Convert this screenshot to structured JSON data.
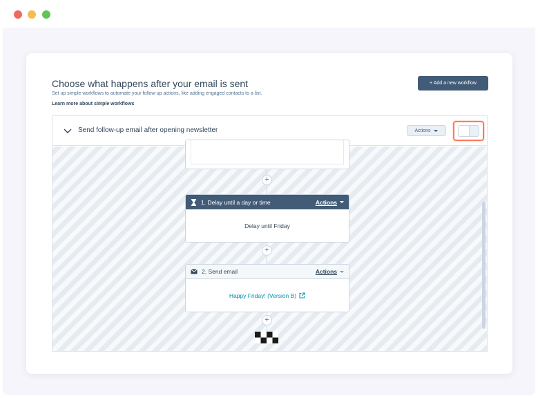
{
  "window": {
    "title_dots": [
      "close",
      "minimize",
      "maximize"
    ]
  },
  "header": {
    "title": "Choose what happens after your email is sent",
    "subtitle": "Set up simple workflows to automate your follow-up actions, like adding engaged contacts to a list.",
    "learn_link": "Learn more about simple workflows",
    "add_button": "+ Add a new workflow"
  },
  "workflow": {
    "name": "Send follow-up email after opening newsletter",
    "actions_label": "Actions",
    "toggle_on": false,
    "plus_symbol": "+",
    "steps": [
      {
        "title": "1. Delay until a day or time",
        "icon": "hourglass-icon",
        "actions_label": "Actions",
        "body_prefix": "Delay until",
        "body_value": "Friday"
      },
      {
        "title": "2. Send email",
        "icon": "envelope-icon",
        "actions_label": "Actions",
        "body_link": "Happy Friday! (Version B)",
        "body_icon": "external-link-icon"
      }
    ]
  },
  "colors": {
    "primary_dark": "#425b76",
    "accent_highlight": "#ff7a59",
    "link": "#0091ae",
    "text": "#33475b"
  }
}
